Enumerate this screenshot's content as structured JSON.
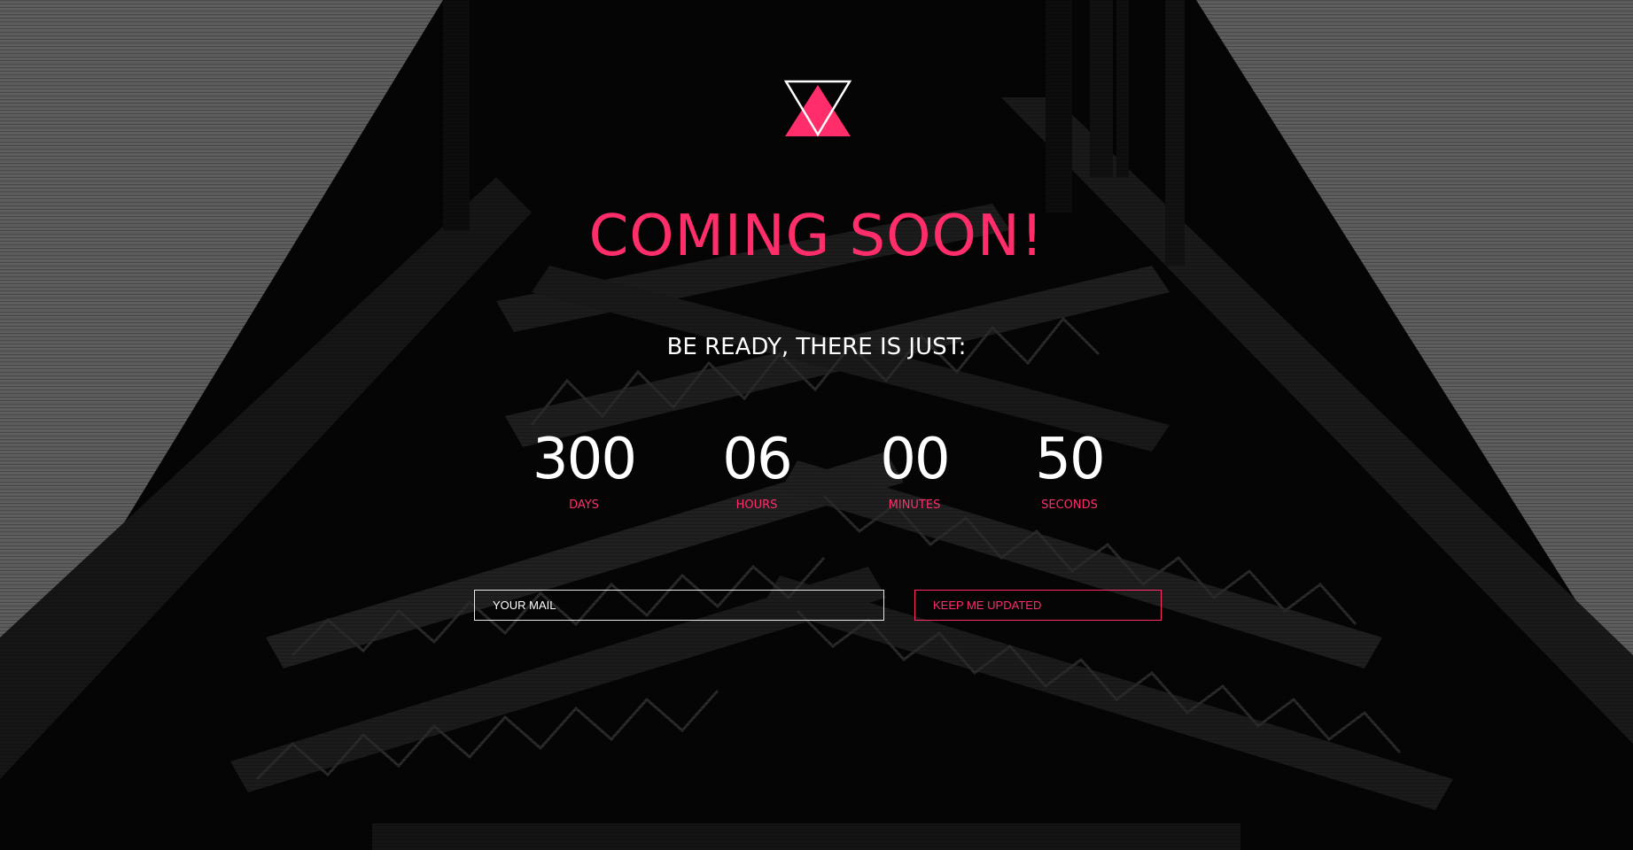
{
  "hero": {
    "title": "COMING SOON!",
    "subtitle": "BE READY, THERE IS JUST:"
  },
  "countdown": {
    "units": [
      {
        "value": "300",
        "label": "DAYS"
      },
      {
        "value": "06",
        "label": "HOURS"
      },
      {
        "value": "00",
        "label": "MINUTES"
      },
      {
        "value": "50",
        "label": "SECONDS"
      }
    ]
  },
  "subscribe": {
    "email_placeholder": "YOUR MAIL",
    "button_label": "KEEP ME UPDATED"
  },
  "theme": {
    "accent": "#ff2e6b",
    "text": "#ffffff",
    "background": "#0a0a0a"
  },
  "logo": {
    "icon": "triangles-logo-icon"
  }
}
